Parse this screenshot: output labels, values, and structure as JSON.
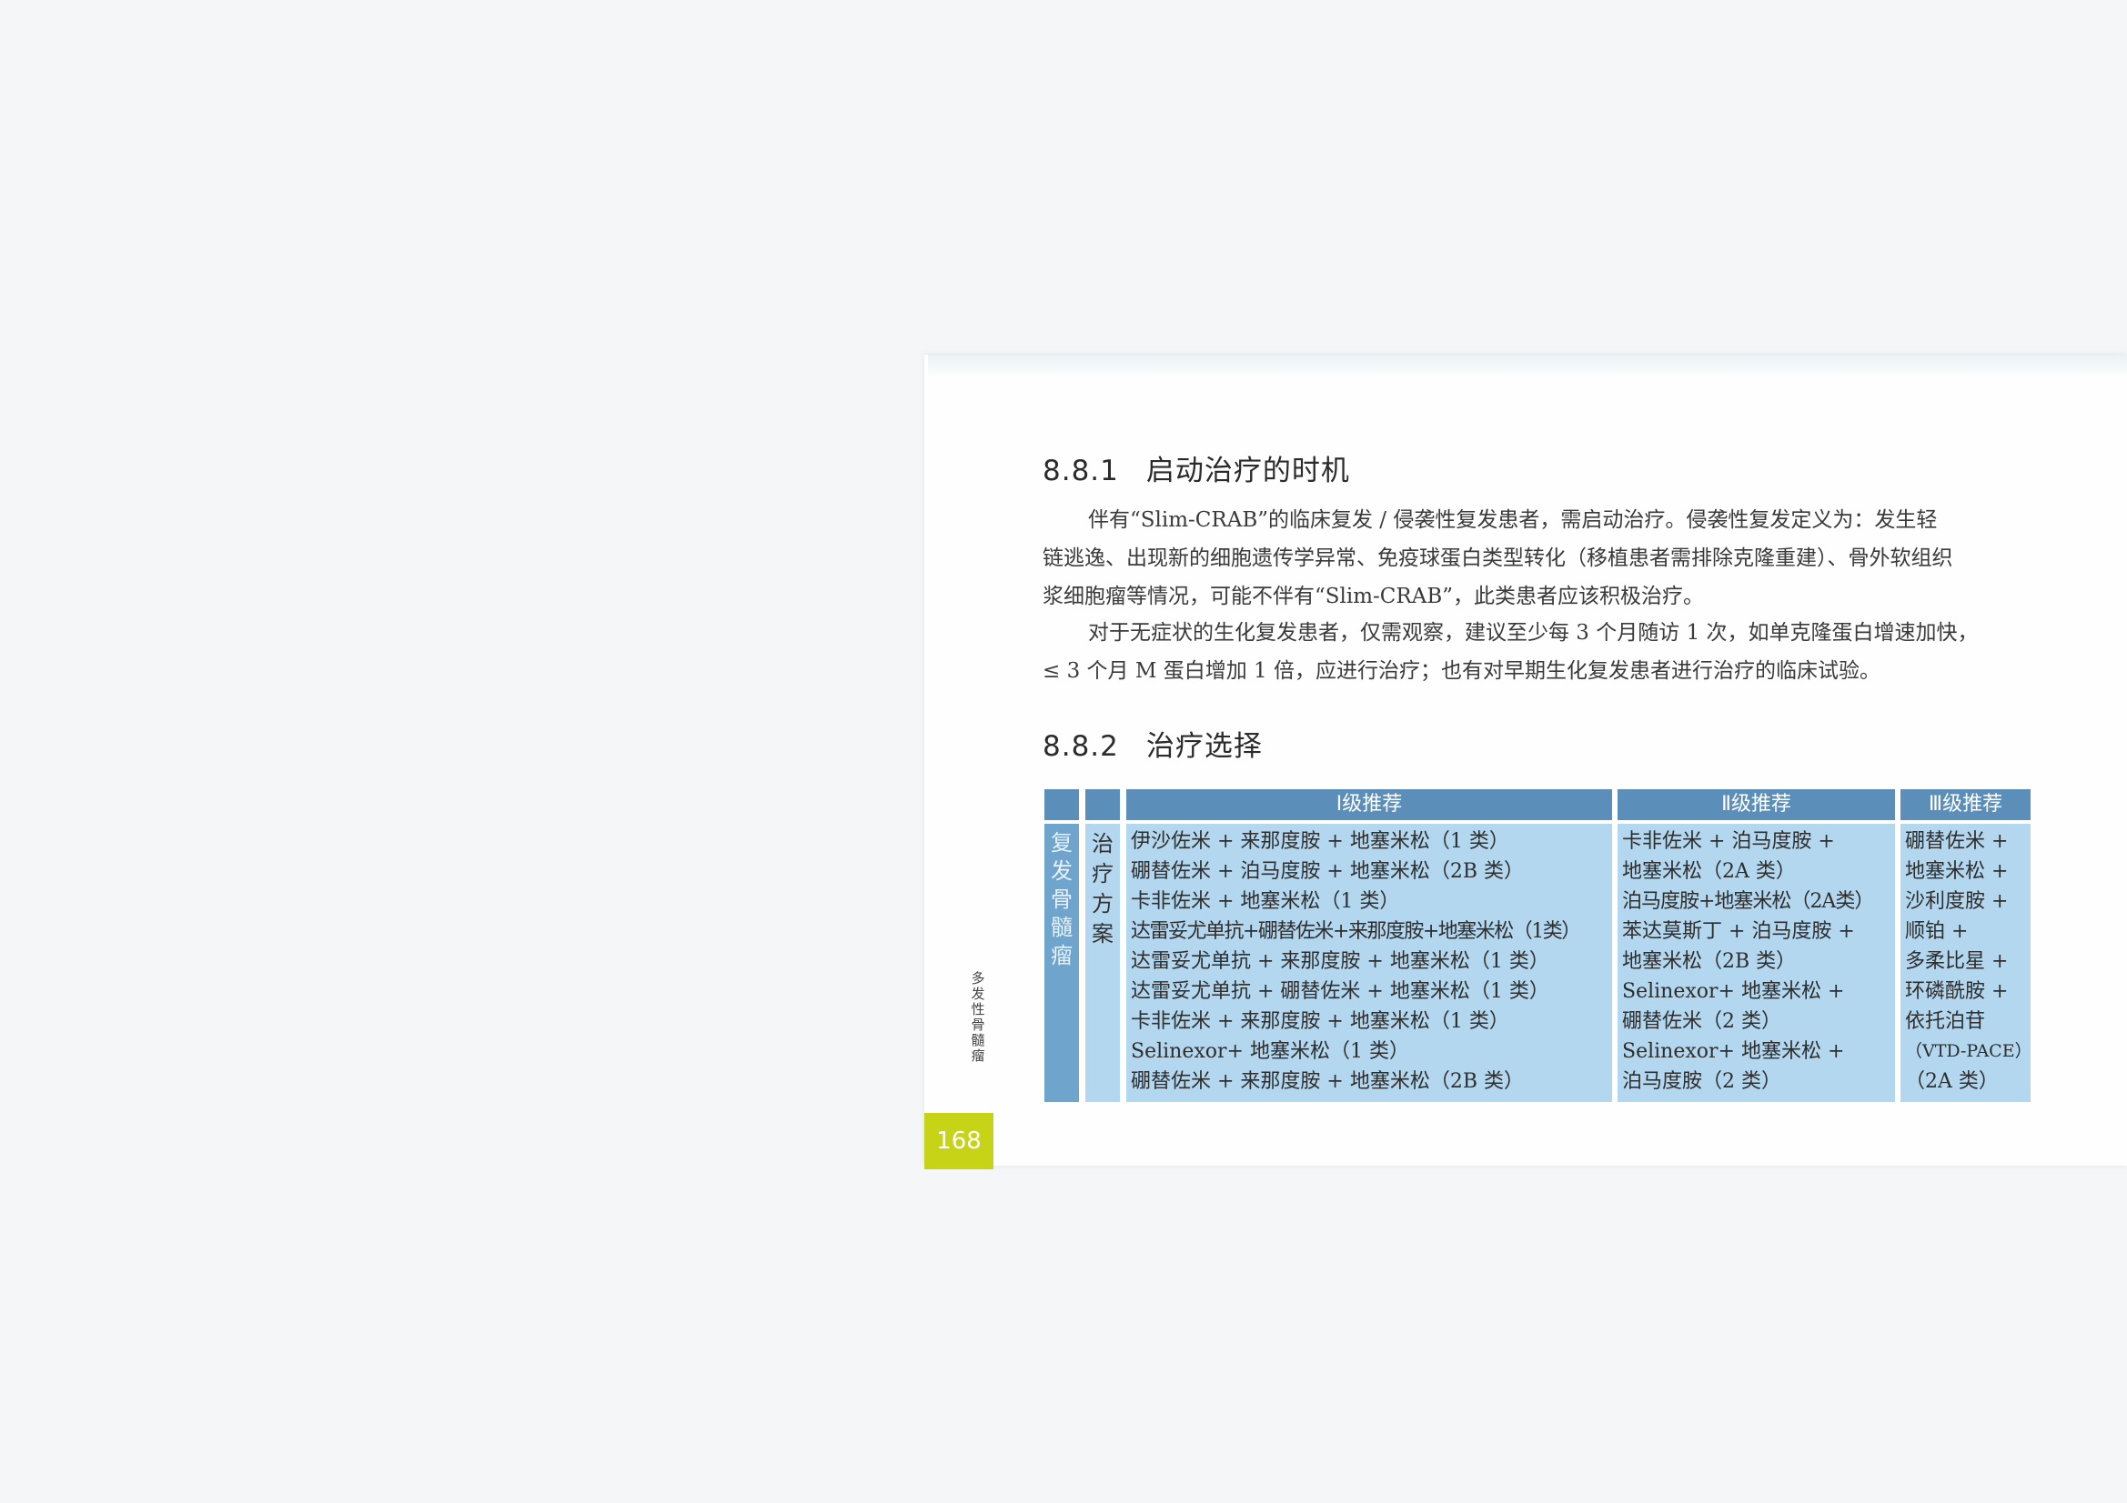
{
  "section1": {
    "number": "8.8.1",
    "title": "启动治疗的时机",
    "paragraphs": [
      {
        "lines": [
          "伴有“Slim-CRAB”的临床复发 / 侵袭性复发患者，需启动治疗。侵袭性复发定义为：发生轻",
          "链逃逸、出现新的细胞遗传学异常、免疫球蛋白类型转化（移植患者需排除克隆重建）、骨外软组织",
          "浆细胞瘤等情况，可能不伴有“Slim-CRAB”，此类患者应该积极治疗。"
        ]
      },
      {
        "lines": [
          "对于无症状的生化复发患者，仅需观察，建议至少每 3 个月随访 1 次，如单克隆蛋白增速加快，",
          "≤ 3 个月 M 蛋白增加 1 倍，应进行治疗；也有对早期生化复发患者进行治疗的临床试验。"
        ]
      }
    ]
  },
  "section2": {
    "number": "8.8.2",
    "title": "治疗选择"
  },
  "table": {
    "headers": [
      "Ⅰ级推荐",
      "Ⅱ级推荐",
      "Ⅲ级推荐"
    ],
    "row_label": [
      "复",
      "发",
      "骨",
      "髓",
      "瘤"
    ],
    "sub_label": [
      "治",
      "疗",
      "方",
      "案"
    ],
    "col1": [
      "伊沙佐米 + 来那度胺 + 地塞米松（1 类）",
      "硼替佐米 + 泊马度胺 + 地塞米松（2B 类）",
      "卡非佐米 + 地塞米松（1 类）",
      "达雷妥尤单抗+硼替佐米+来那度胺+地塞米松（1类）",
      "达雷妥尤单抗 + 来那度胺 + 地塞米松（1 类）",
      "达雷妥尤单抗 + 硼替佐米 + 地塞米松（1 类）",
      "卡非佐米 + 来那度胺 + 地塞米松（1 类）",
      "Selinexor+ 地塞米松（1 类）",
      "硼替佐米 + 来那度胺 + 地塞米松（2B 类）"
    ],
    "col2": [
      "卡非佐米 + 泊马度胺 +",
      "地塞米松（2A 类）",
      "泊马度胺+地塞米松（2A类）",
      "苯达莫斯丁 + 泊马度胺 +",
      "地塞米松（2B 类）",
      "Selinexor+ 地塞米松 +",
      "硼替佐米（2 类）",
      "Selinexor+ 地塞米松 +",
      "泊马度胺（2 类）"
    ],
    "col3": [
      "硼替佐米 +",
      "地塞米松 +",
      "沙利度胺 +",
      "顺铂 +",
      "多柔比星 +",
      "环磷酰胺 +",
      "依托泊苷",
      "（VTD-PACE）",
      "（2A 类）"
    ]
  },
  "spine_text": [
    "多",
    "发",
    "性",
    "骨",
    "髓",
    "瘤"
  ],
  "page_number": "168",
  "colors": {
    "header_blue": "#5b8fba",
    "side_blue": "#6fa4cd",
    "cell_blue": "#b3d7ef",
    "page_tab": "#c7d317"
  }
}
